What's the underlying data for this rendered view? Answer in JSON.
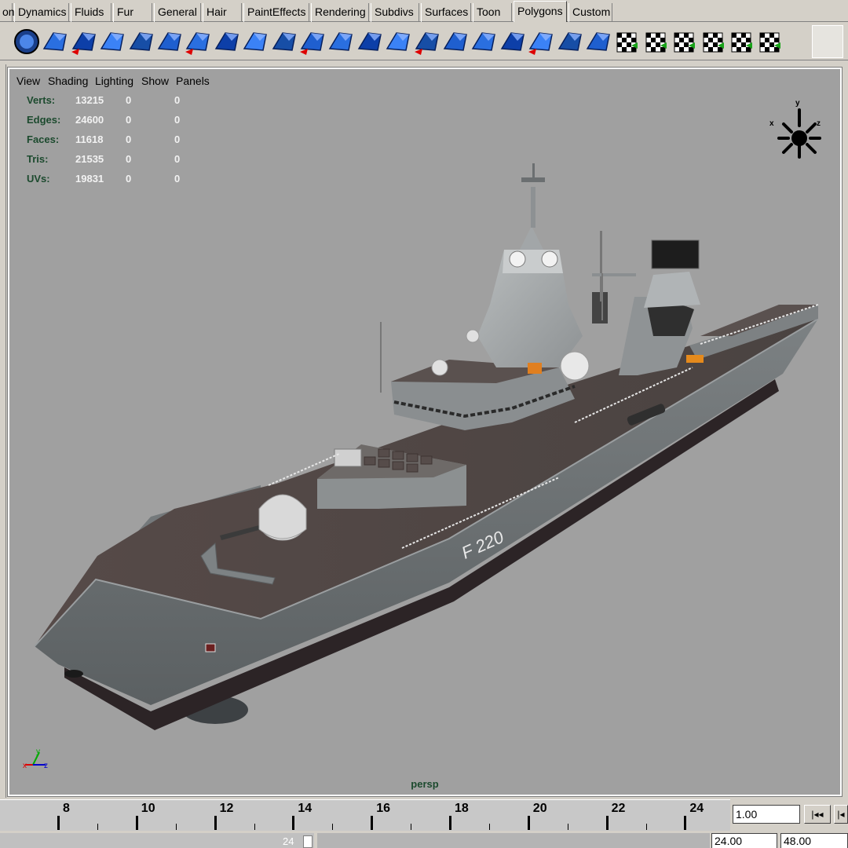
{
  "shelf_tabs": [
    {
      "label": "on",
      "active": false
    },
    {
      "label": "Dynamics",
      "active": false
    },
    {
      "label": "Fluids",
      "active": false
    },
    {
      "label": "Fur",
      "active": false
    },
    {
      "label": "General",
      "active": false
    },
    {
      "label": "Hair",
      "active": false
    },
    {
      "label": "PaintEffects",
      "active": false
    },
    {
      "label": "Rendering",
      "active": false
    },
    {
      "label": "Subdivs",
      "active": false
    },
    {
      "label": "Surfaces",
      "active": false
    },
    {
      "label": "Toon",
      "active": false
    },
    {
      "label": "Polygons",
      "active": true
    },
    {
      "label": "Custom",
      "active": false
    }
  ],
  "shelf_icons": [
    "poly-cylinder-icon",
    "poly-sphere-icon",
    "poly-cube-group-icon",
    "combine-icon",
    "separate-icon",
    "poly-cube-icon",
    "smooth-proxy-icon",
    "extrude-face-icon",
    "split-polygon-icon",
    "extrude-edge-icon",
    "bevel-icon",
    "wedge-face-icon",
    "append-polygon-icon",
    "merge-vertices-icon",
    "collapse-icon",
    "split-edge-icon",
    "cut-faces-icon",
    "poke-face-icon",
    "subdivide-icon",
    "mirror-icon",
    "sculpt-icon",
    "planar-map-icon",
    "automatic-map-icon",
    "cylindrical-map-icon",
    "spherical-map-icon",
    "uv-layout-icon",
    "uv-texture-editor-icon"
  ],
  "panel_menu": [
    "View",
    "Shading",
    "Lighting",
    "Show",
    "Panels"
  ],
  "hud": [
    {
      "label": "Verts:",
      "v1": "13215",
      "v2": "0",
      "v3": "0"
    },
    {
      "label": "Edges:",
      "v1": "24600",
      "v2": "0",
      "v3": "0"
    },
    {
      "label": "Faces:",
      "v1": "11618",
      "v2": "0",
      "v3": "0"
    },
    {
      "label": "Tris:",
      "v1": "21535",
      "v2": "0",
      "v3": "0"
    },
    {
      "label": "UVs:",
      "v1": "19831",
      "v2": "0",
      "v3": "0"
    }
  ],
  "view_cube": {
    "x": "x",
    "y": "y",
    "z": "z"
  },
  "axis_gizmo": {
    "x": "x",
    "y": "y",
    "z": "z"
  },
  "camera_label": "persp",
  "model": {
    "hull_number": "F 220"
  },
  "timeline": {
    "labels": [
      "8",
      "10",
      "12",
      "14",
      "16",
      "18",
      "20",
      "22",
      "24"
    ],
    "current_frame": "1.00",
    "range_start_label": "24",
    "end_time": "24.00",
    "max_time": "48.00",
    "rewind_glyph": "|◂◂",
    "step_glyph": "|◂"
  },
  "colors": {
    "viewport_bg": "#a0a0a0",
    "hud_label": "#1c4a2e",
    "hud_value": "#f2f2f2",
    "hull": "#6f7476",
    "deck": "#4e4644"
  }
}
